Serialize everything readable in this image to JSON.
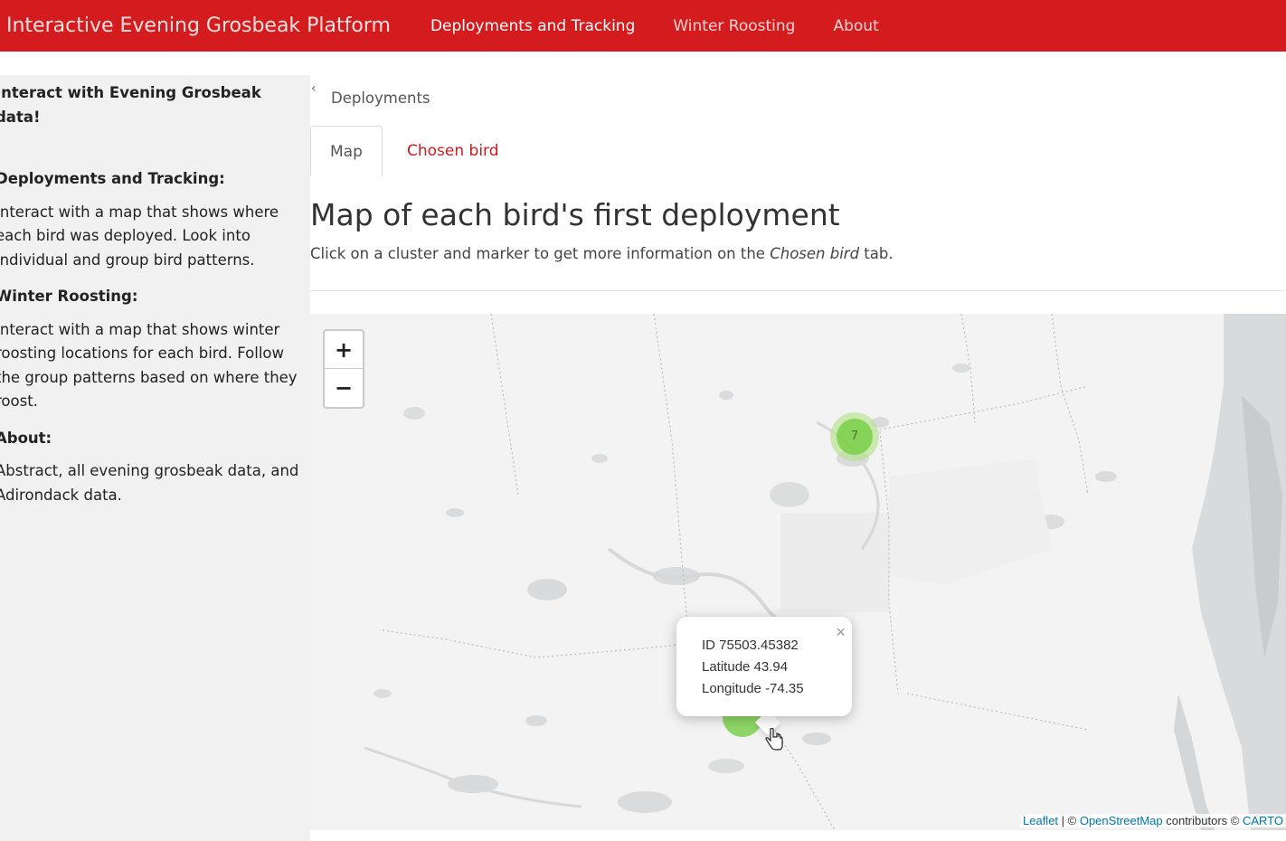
{
  "navbar": {
    "brand": "Interactive Evening Grosbeak Platform",
    "links": [
      "Deployments and Tracking",
      "Winter Roosting",
      "About"
    ],
    "color": "#d41c1f"
  },
  "sidebar": {
    "collapse_icon": "chevron-left-icon",
    "title": "Interact with Evening Grosbeak data!",
    "sections": [
      {
        "heading": "Deployments and Tracking:",
        "text": "Interact with a map that shows where each bird was deployed. Look into individual and group bird patterns."
      },
      {
        "heading": "Winter Roosting:",
        "text": "Interact with a map that shows winter roosting locations for each bird. Follow the group patterns based on where they roost."
      },
      {
        "heading": "About:",
        "text": "Abstract, all evening grosbeak data, and Adirondack data."
      }
    ]
  },
  "main": {
    "breadcrumb": "Deployments",
    "tabs": [
      {
        "label": "Map",
        "active": true
      },
      {
        "label": "Chosen bird",
        "active": false
      }
    ],
    "title": "Map of each bird's first deployment",
    "description_before": "Click on a cluster and marker to get more information on the ",
    "description_em": "Chosen bird",
    "description_after": " tab."
  },
  "map": {
    "zoom_in": "+",
    "zoom_out": "−",
    "clusters": [
      {
        "count": "7"
      }
    ],
    "popup": {
      "close": "×",
      "id_line": "ID 75503.45382",
      "lat_line": "Latitude 43.94",
      "lon_line": "Longitude -74.35"
    },
    "attribution": {
      "leaflet": "Leaflet",
      "sep1": " | © ",
      "osm": "OpenStreetMap",
      "mid": " contributors © ",
      "carto": "CARTO"
    }
  }
}
